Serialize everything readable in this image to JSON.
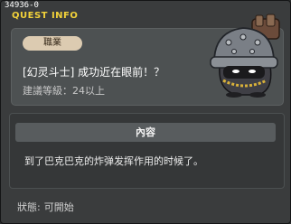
{
  "window": {
    "quest_id": "34936-0",
    "title": "QUEST INFO"
  },
  "info": {
    "tag": "職業",
    "quest_name": "[幻灵斗士] 成功近在眼前！？",
    "required_level": "建議等級：24以上",
    "npc_icon": "armored-helmet-npc-portrait"
  },
  "content": {
    "header": "內容",
    "text": "到了巴克巴克的炸弹发挥作用的时候了。"
  },
  "status": {
    "label": "狀態:",
    "value": "可開始"
  },
  "colors": {
    "title": "#f2d23a",
    "tag_bg": "#dccbb1",
    "panel_bg": "#4d5152",
    "window_bg": "#3a3c3d"
  }
}
